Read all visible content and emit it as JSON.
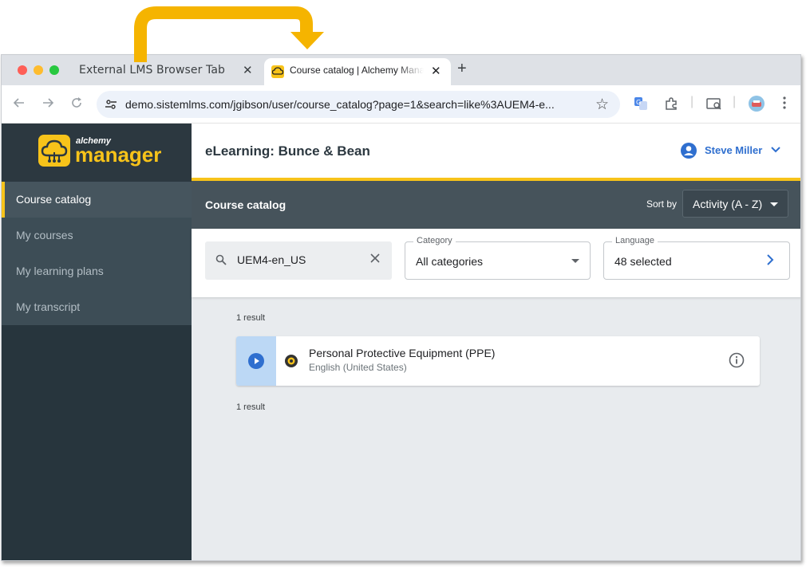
{
  "browser": {
    "tabs": [
      {
        "title": "External LMS Browser Tab",
        "active": false
      },
      {
        "title": "Course catalog | Alchemy Manager",
        "active": true
      }
    ],
    "new_tab_label": "+",
    "close_glyph": "✕",
    "url": "demo.sistemlms.com/jgibson/user/course_catalog?page=1&search=like%3AUEM4-e...",
    "toolbar_icons": [
      "back-icon",
      "forward-icon",
      "reload-icon",
      "site-settings-icon",
      "bookmark-star-icon",
      "translate-icon",
      "extensions-icon",
      "reading-list-icon",
      "profile-avatar-icon",
      "more-menu-icon"
    ]
  },
  "app": {
    "logo": {
      "small": "alchemy",
      "big": "manager"
    },
    "sidebar": {
      "items": [
        {
          "label": "Course catalog",
          "active": true
        },
        {
          "label": "My courses",
          "active": false
        },
        {
          "label": "My learning plans",
          "active": false
        },
        {
          "label": "My transcript",
          "active": false
        }
      ]
    },
    "header": {
      "title": "eLearning: Bunce & Bean",
      "user_name": "Steve Miller"
    },
    "catalog_bar": {
      "title": "Course catalog",
      "sort_label": "Sort by",
      "sort_value": "Activity (A - Z)"
    },
    "filters": {
      "search_value": "UEM4-en_US",
      "category": {
        "legend": "Category",
        "value": "All categories"
      },
      "language": {
        "legend": "Language",
        "value": "48 selected"
      }
    },
    "results": {
      "count_top": "1 result",
      "count_bottom": "1 result",
      "courses": [
        {
          "name": "Personal Protective Equipment (PPE)",
          "language": "English (United States)"
        }
      ]
    }
  },
  "colors": {
    "accent_yellow": "#f7c31a",
    "sidebar_dark": "#27353d",
    "link_blue": "#2f6fcf",
    "catalog_bar": "#46535b"
  }
}
